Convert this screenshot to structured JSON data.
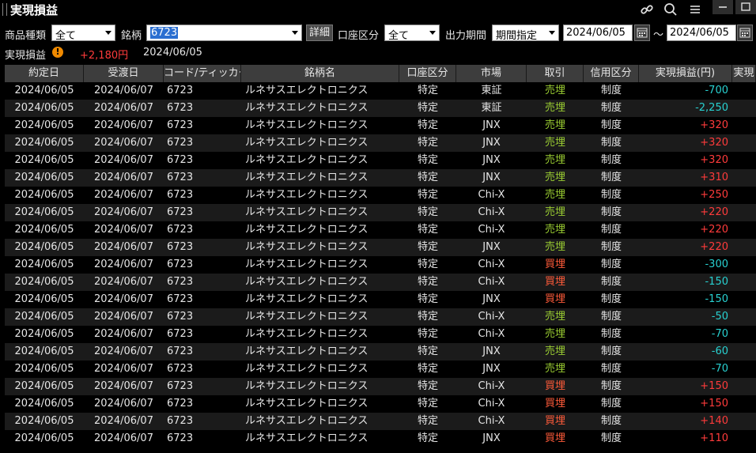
{
  "window": {
    "title": "実現損益",
    "colors": {
      "background": "#000000",
      "header": "#3d3d3d",
      "sell": "#9acd32",
      "buy": "#ff5b3a",
      "positive": "#ff3b3b",
      "negative": "#28d1d1"
    }
  },
  "toolbar_icons": [
    "link-icon",
    "search-icon",
    "menu-icon",
    "minimize-icon",
    "maximize-icon"
  ],
  "filters": {
    "product_type_label": "商品種類",
    "product_type_value": "全て",
    "symbol_label": "銘柄",
    "symbol_value": "6723",
    "detail_button": "詳細",
    "account_label": "口座区分",
    "account_value": "全て",
    "period_label": "出力期間",
    "period_value": "期間指定",
    "date_from": "2024/06/05",
    "tilde": "～",
    "date_to": "2024/06/05"
  },
  "summary": {
    "label": "実現損益",
    "warning_glyph": "!",
    "value": "+2,180円",
    "date": "2024/06/05"
  },
  "table": {
    "columns": [
      "約定日",
      "受渡日",
      "コード/ティッカー",
      "銘柄名",
      "口座区分",
      "市場",
      "取引",
      "信用区分",
      "実現損益(円)",
      "実現"
    ],
    "rows": [
      {
        "trade_date": "2024/06/05",
        "settle_date": "2024/06/07",
        "code": "6723",
        "name": "ルネサスエレクトロニクス",
        "account": "特定",
        "market": "東証",
        "trade": "売埋",
        "trade_type": "sell",
        "credit": "制度",
        "pl": "-700",
        "pl_sign": "neg"
      },
      {
        "trade_date": "2024/06/05",
        "settle_date": "2024/06/07",
        "code": "6723",
        "name": "ルネサスエレクトロニクス",
        "account": "特定",
        "market": "東証",
        "trade": "売埋",
        "trade_type": "sell",
        "credit": "制度",
        "pl": "-2,250",
        "pl_sign": "neg"
      },
      {
        "trade_date": "2024/06/05",
        "settle_date": "2024/06/07",
        "code": "6723",
        "name": "ルネサスエレクトロニクス",
        "account": "特定",
        "market": "JNX",
        "trade": "売埋",
        "trade_type": "sell",
        "credit": "制度",
        "pl": "+320",
        "pl_sign": "pos"
      },
      {
        "trade_date": "2024/06/05",
        "settle_date": "2024/06/07",
        "code": "6723",
        "name": "ルネサスエレクトロニクス",
        "account": "特定",
        "market": "JNX",
        "trade": "売埋",
        "trade_type": "sell",
        "credit": "制度",
        "pl": "+320",
        "pl_sign": "pos"
      },
      {
        "trade_date": "2024/06/05",
        "settle_date": "2024/06/07",
        "code": "6723",
        "name": "ルネサスエレクトロニクス",
        "account": "特定",
        "market": "JNX",
        "trade": "売埋",
        "trade_type": "sell",
        "credit": "制度",
        "pl": "+320",
        "pl_sign": "pos"
      },
      {
        "trade_date": "2024/06/05",
        "settle_date": "2024/06/07",
        "code": "6723",
        "name": "ルネサスエレクトロニクス",
        "account": "特定",
        "market": "JNX",
        "trade": "売埋",
        "trade_type": "sell",
        "credit": "制度",
        "pl": "+310",
        "pl_sign": "pos"
      },
      {
        "trade_date": "2024/06/05",
        "settle_date": "2024/06/07",
        "code": "6723",
        "name": "ルネサスエレクトロニクス",
        "account": "特定",
        "market": "Chi-X",
        "trade": "売埋",
        "trade_type": "sell",
        "credit": "制度",
        "pl": "+250",
        "pl_sign": "pos"
      },
      {
        "trade_date": "2024/06/05",
        "settle_date": "2024/06/07",
        "code": "6723",
        "name": "ルネサスエレクトロニクス",
        "account": "特定",
        "market": "Chi-X",
        "trade": "売埋",
        "trade_type": "sell",
        "credit": "制度",
        "pl": "+220",
        "pl_sign": "pos"
      },
      {
        "trade_date": "2024/06/05",
        "settle_date": "2024/06/07",
        "code": "6723",
        "name": "ルネサスエレクトロニクス",
        "account": "特定",
        "market": "Chi-X",
        "trade": "売埋",
        "trade_type": "sell",
        "credit": "制度",
        "pl": "+220",
        "pl_sign": "pos"
      },
      {
        "trade_date": "2024/06/05",
        "settle_date": "2024/06/07",
        "code": "6723",
        "name": "ルネサスエレクトロニクス",
        "account": "特定",
        "market": "JNX",
        "trade": "売埋",
        "trade_type": "sell",
        "credit": "制度",
        "pl": "+220",
        "pl_sign": "pos"
      },
      {
        "trade_date": "2024/06/05",
        "settle_date": "2024/06/07",
        "code": "6723",
        "name": "ルネサスエレクトロニクス",
        "account": "特定",
        "market": "Chi-X",
        "trade": "買埋",
        "trade_type": "buy",
        "credit": "制度",
        "pl": "-300",
        "pl_sign": "neg"
      },
      {
        "trade_date": "2024/06/05",
        "settle_date": "2024/06/07",
        "code": "6723",
        "name": "ルネサスエレクトロニクス",
        "account": "特定",
        "market": "Chi-X",
        "trade": "買埋",
        "trade_type": "buy",
        "credit": "制度",
        "pl": "-150",
        "pl_sign": "neg"
      },
      {
        "trade_date": "2024/06/05",
        "settle_date": "2024/06/07",
        "code": "6723",
        "name": "ルネサスエレクトロニクス",
        "account": "特定",
        "market": "JNX",
        "trade": "買埋",
        "trade_type": "buy",
        "credit": "制度",
        "pl": "-150",
        "pl_sign": "neg"
      },
      {
        "trade_date": "2024/06/05",
        "settle_date": "2024/06/07",
        "code": "6723",
        "name": "ルネサスエレクトロニクス",
        "account": "特定",
        "market": "Chi-X",
        "trade": "売埋",
        "trade_type": "sell",
        "credit": "制度",
        "pl": "-50",
        "pl_sign": "neg"
      },
      {
        "trade_date": "2024/06/05",
        "settle_date": "2024/06/07",
        "code": "6723",
        "name": "ルネサスエレクトロニクス",
        "account": "特定",
        "market": "Chi-X",
        "trade": "売埋",
        "trade_type": "sell",
        "credit": "制度",
        "pl": "-70",
        "pl_sign": "neg"
      },
      {
        "trade_date": "2024/06/05",
        "settle_date": "2024/06/07",
        "code": "6723",
        "name": "ルネサスエレクトロニクス",
        "account": "特定",
        "market": "JNX",
        "trade": "売埋",
        "trade_type": "sell",
        "credit": "制度",
        "pl": "-60",
        "pl_sign": "neg"
      },
      {
        "trade_date": "2024/06/05",
        "settle_date": "2024/06/07",
        "code": "6723",
        "name": "ルネサスエレクトロニクス",
        "account": "特定",
        "market": "JNX",
        "trade": "売埋",
        "trade_type": "sell",
        "credit": "制度",
        "pl": "-70",
        "pl_sign": "neg"
      },
      {
        "trade_date": "2024/06/05",
        "settle_date": "2024/06/07",
        "code": "6723",
        "name": "ルネサスエレクトロニクス",
        "account": "特定",
        "market": "Chi-X",
        "trade": "買埋",
        "trade_type": "buy",
        "credit": "制度",
        "pl": "+150",
        "pl_sign": "pos"
      },
      {
        "trade_date": "2024/06/05",
        "settle_date": "2024/06/07",
        "code": "6723",
        "name": "ルネサスエレクトロニクス",
        "account": "特定",
        "market": "Chi-X",
        "trade": "買埋",
        "trade_type": "buy",
        "credit": "制度",
        "pl": "+150",
        "pl_sign": "pos"
      },
      {
        "trade_date": "2024/06/05",
        "settle_date": "2024/06/07",
        "code": "6723",
        "name": "ルネサスエレクトロニクス",
        "account": "特定",
        "market": "Chi-X",
        "trade": "買埋",
        "trade_type": "buy",
        "credit": "制度",
        "pl": "+140",
        "pl_sign": "pos"
      },
      {
        "trade_date": "2024/06/05",
        "settle_date": "2024/06/07",
        "code": "6723",
        "name": "ルネサスエレクトロニクス",
        "account": "特定",
        "market": "JNX",
        "trade": "買埋",
        "trade_type": "buy",
        "credit": "制度",
        "pl": "+110",
        "pl_sign": "pos"
      }
    ]
  }
}
